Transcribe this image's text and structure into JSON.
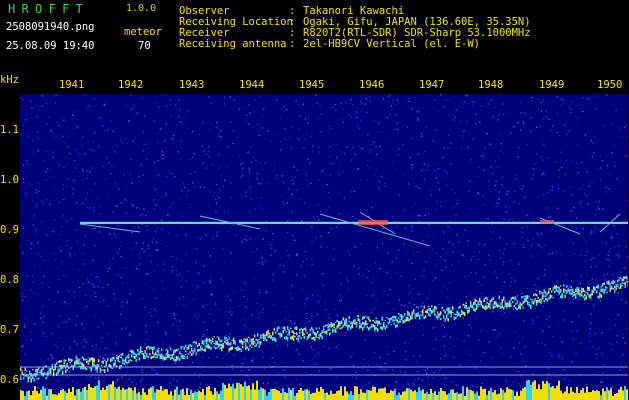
{
  "app": {
    "name": "HROFFT",
    "version": "1.0.0"
  },
  "file": {
    "name": "2508091940.png",
    "datetime": "25.08.09 19:40"
  },
  "meteor": {
    "label": "meteor",
    "count": "70"
  },
  "info": [
    {
      "label": "Observer",
      "value": "Takanori Kawachi"
    },
    {
      "label": "Receiving Location",
      "value": "Ogaki, Gifu, JAPAN (136.60E, 35.35N)"
    },
    {
      "label": "Receiver",
      "value": "R820T2(RTL-SDR) SDR-Sharp 53.1000MHz"
    },
    {
      "label": "Receiving antenna",
      "value": "2el-HB9CV Vertical (el. E-W)"
    }
  ],
  "axis": {
    "freq_unit": "kHz",
    "freq_labels": [
      "1.1",
      "1.0",
      "0.9",
      "0.8",
      "0.7",
      "0.6"
    ],
    "time_labels": [
      "1941",
      "1942",
      "1943",
      "1944",
      "1945",
      "1946",
      "1947",
      "1948",
      "1949",
      "1950"
    ]
  },
  "colors": {
    "green": "#39d24a",
    "yellow": "#f0e000",
    "white": "#ffffff",
    "background": "#000000",
    "noise": "#000078"
  }
}
